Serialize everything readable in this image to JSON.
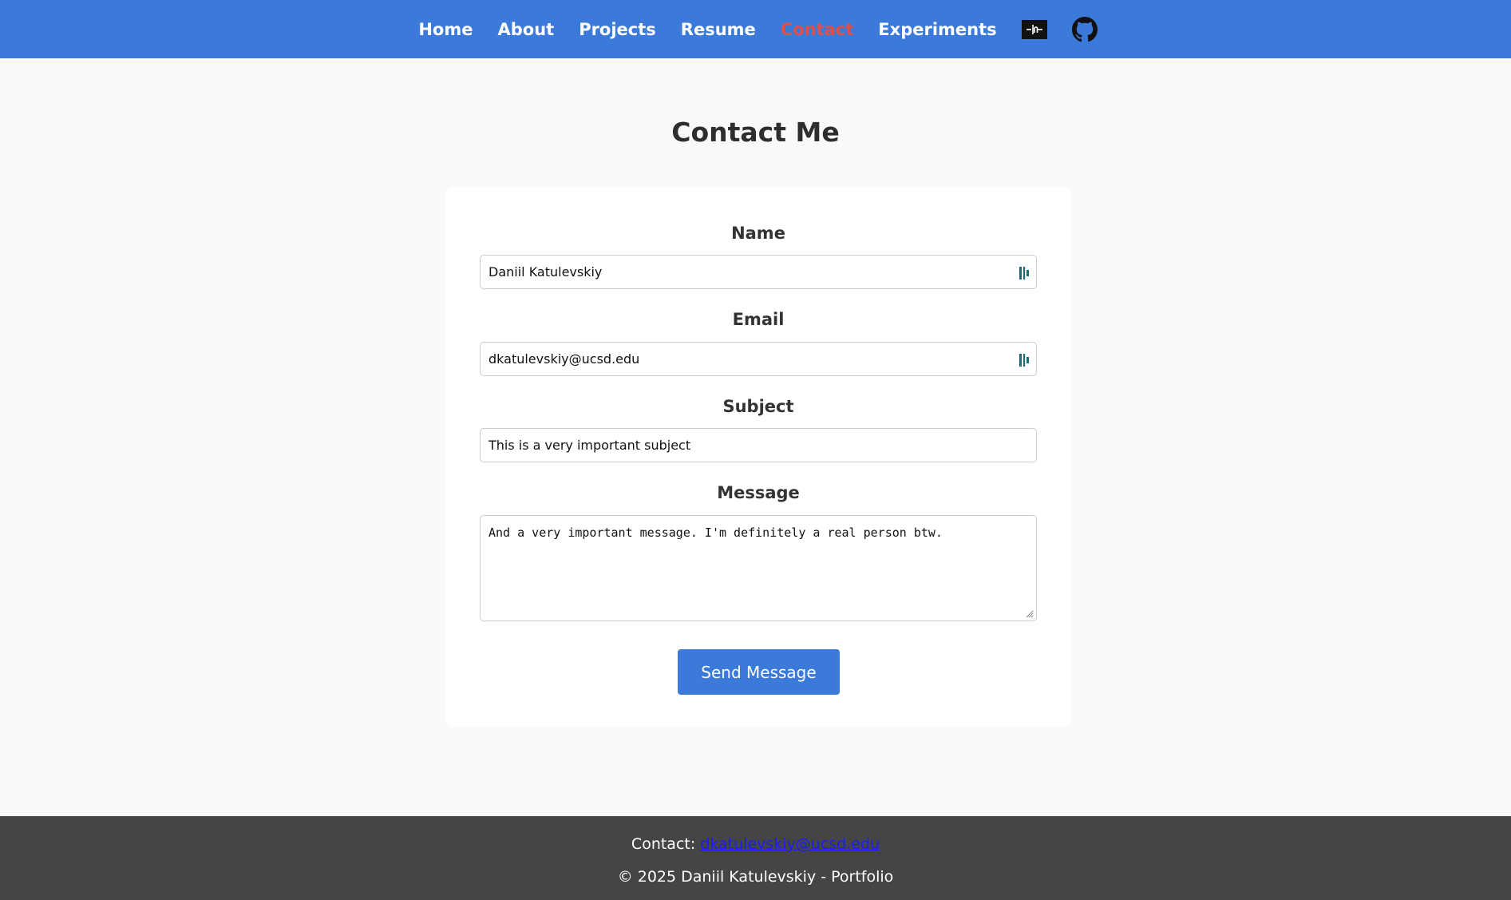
{
  "nav": {
    "items": [
      {
        "label": "Home"
      },
      {
        "label": "About"
      },
      {
        "label": "Projects"
      },
      {
        "label": "Resume"
      },
      {
        "label": "Contact",
        "active": true
      },
      {
        "label": "Experiments"
      }
    ],
    "icons": [
      "terminal-logo-icon",
      "github-icon"
    ]
  },
  "page": {
    "title": "Contact Me"
  },
  "form": {
    "name_label": "Name",
    "name_value": "Daniil Katulevskiy",
    "email_label": "Email",
    "email_value": "dkatulevskiy@ucsd.edu",
    "subject_label": "Subject",
    "subject_value": "This is a very important subject",
    "message_label": "Message",
    "message_value": "And a very important message. I'm definitely a real person btw.",
    "submit_label": "Send Message"
  },
  "footer": {
    "contact_prefix": "Contact: ",
    "contact_email": "dkatulevskiy@ucsd.edu",
    "copyright": "© 2025 Daniil Katulevskiy - Portfolio"
  },
  "colors": {
    "nav_bg": "#3b7ad9",
    "active_link": "#e0504a",
    "button_bg": "#3b7ad9",
    "footer_bg": "#454545",
    "page_bg": "#f9f9f9",
    "autofill_icon": "#1e6a7a"
  }
}
